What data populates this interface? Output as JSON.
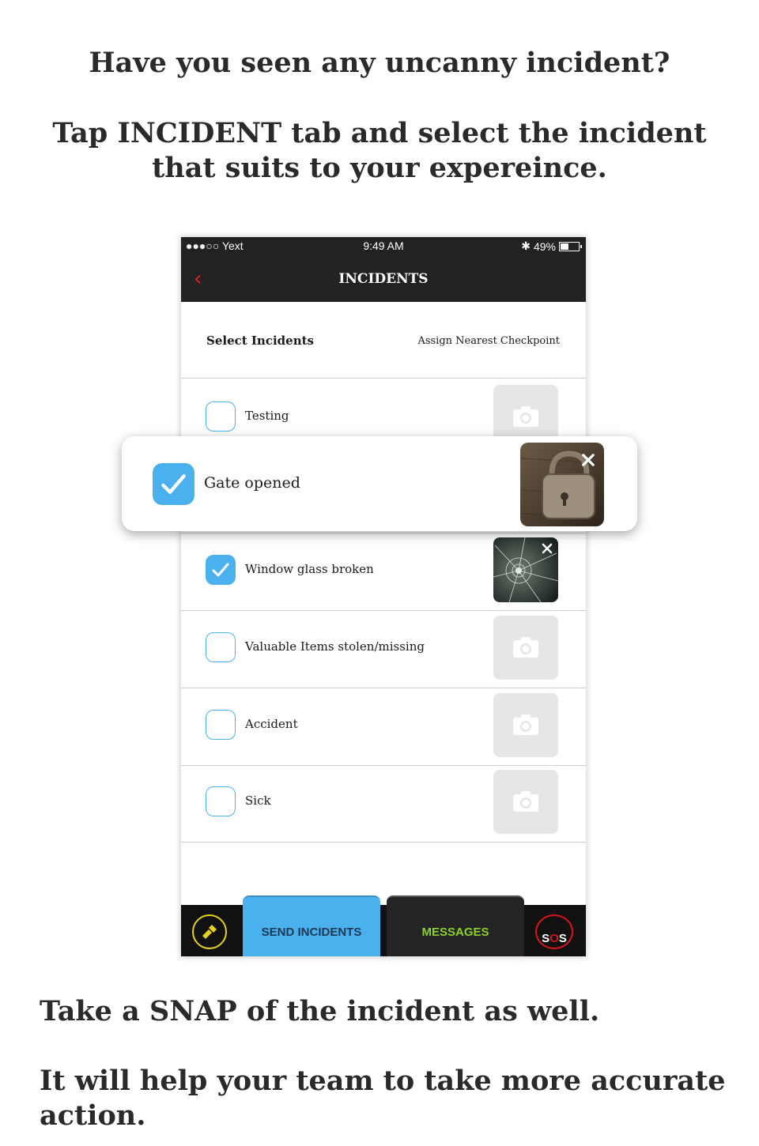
{
  "captions": {
    "top1": "Have you seen any uncanny incident?",
    "top2": "Tap INCIDENT tab and select the incident that suits to your expereince.",
    "bottom1": "Take a SNAP of the incident as well.",
    "bottom2": "It will help your team to take more accurate action."
  },
  "status_bar": {
    "carrier": "●●●○○ Yext",
    "time": "9:49 AM",
    "battery": "49%"
  },
  "nav": {
    "title": "INCIDENTS",
    "back_icon": "chevron-left-icon"
  },
  "header": {
    "select_label": "Select Incidents",
    "assign_label": "Assign Nearest Checkpoint"
  },
  "incidents": [
    {
      "label": "Testing",
      "checked": false
    },
    {
      "label": "Gate opened",
      "checked": true
    },
    {
      "label": "Window glass broken",
      "checked": true
    },
    {
      "label": "Valuable Items stolen/missing",
      "checked": false
    },
    {
      "label": "Accident",
      "checked": false
    },
    {
      "label": "Sick",
      "checked": false
    }
  ],
  "bottom_bar": {
    "send_label": "SEND INCIDENTS",
    "messages_label": "MESSAGES",
    "sos_s1": "S",
    "sos_o": "O",
    "sos_s2": "S"
  },
  "colors": {
    "accent": "#4ab1ee",
    "nav_bg": "#222222",
    "messages_text": "#8dd02b",
    "sos_red": "#d8141f",
    "torch_yellow": "#e6d21e"
  }
}
